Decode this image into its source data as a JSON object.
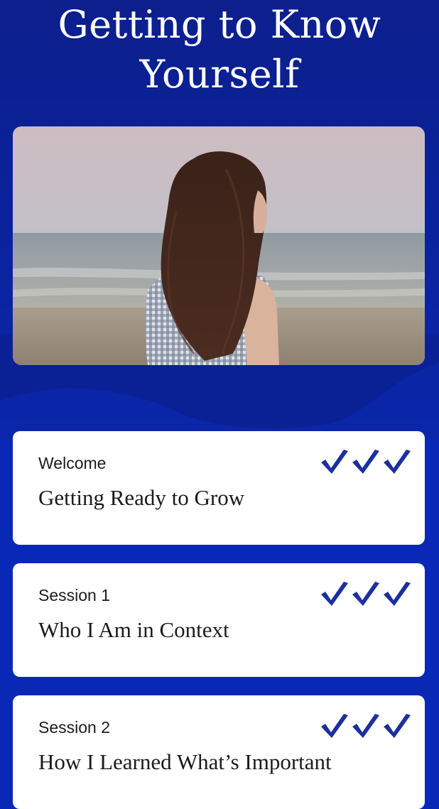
{
  "page": {
    "title": "Getting to Know Yourself"
  },
  "hero_image": {
    "alt": "woman-on-beach-photo"
  },
  "sessions": [
    {
      "label": "Welcome",
      "title": "Getting Ready to Grow",
      "checks": 3
    },
    {
      "label": "Session 1",
      "title": "Who I Am in Context",
      "checks": 3
    },
    {
      "label": "Session 2",
      "title": "How I Learned What’s Important",
      "checks": 3
    }
  ],
  "colors": {
    "background": "#0a28b6",
    "card": "#ffffff",
    "check": "#1c2f9e"
  }
}
